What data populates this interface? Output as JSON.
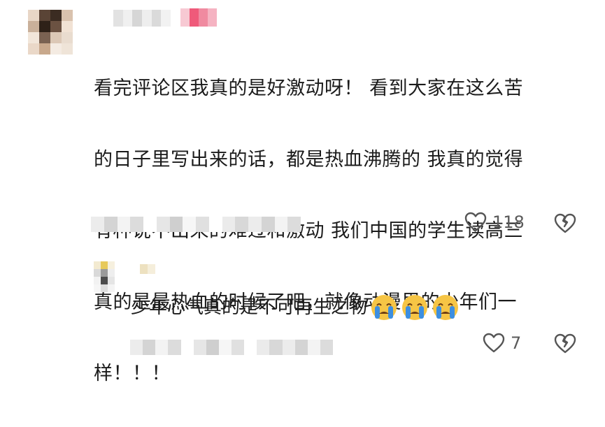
{
  "comment": {
    "text_lines": [
      "看完评论区我真的是好激动呀！  看到大家在这么苦",
      "的日子里写出来的话，都是热血沸腾的  我真的觉得",
      "有种说不出来的难过和激动  我们中国的学生读高三",
      "真的是最热血的时候了吧，就像动漫里的少年们一",
      "样！！！"
    ],
    "like_count": "118"
  },
  "reply": {
    "text": "少年心气真的是不可再生之物",
    "emoji_icons": [
      "crying-face-icon",
      "crying-face-icon",
      "crying-face-icon"
    ],
    "like_count": "7"
  },
  "colors": {
    "text": "#1b1b1b",
    "count": "#5a5a5a",
    "icon_stroke": "#555555",
    "emoji_face": "#f6c545",
    "emoji_tear": "#3d8fe0"
  }
}
